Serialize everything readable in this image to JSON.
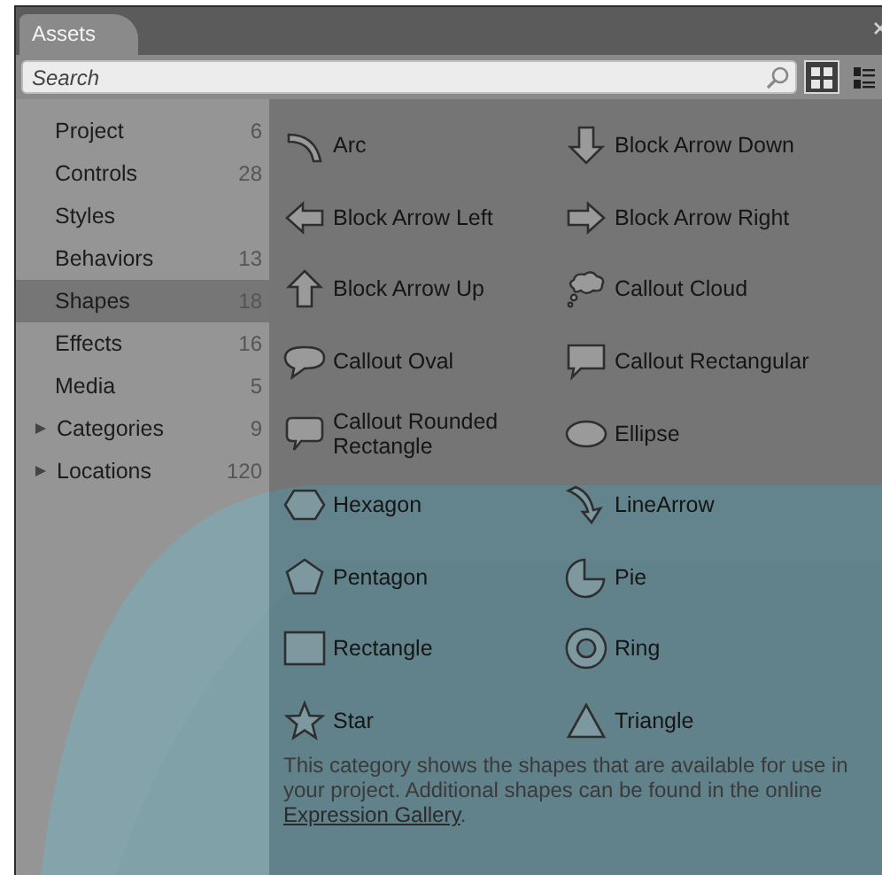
{
  "panel": {
    "tab": "Assets"
  },
  "search": {
    "placeholder": "Search"
  },
  "view_buttons": [
    {
      "kind": "grid",
      "selected": true
    },
    {
      "kind": "list",
      "selected": false
    }
  ],
  "categories": [
    {
      "name": "Project",
      "count": "6",
      "selected": false
    },
    {
      "name": "Controls",
      "count": "28",
      "selected": false
    },
    {
      "name": "Styles",
      "selected": false
    },
    {
      "name": "Behaviors",
      "count": "13",
      "selected": false
    },
    {
      "name": "Shapes",
      "count": "18",
      "selected": true
    },
    {
      "name": "Effects",
      "count": "16",
      "selected": false
    },
    {
      "name": "Media",
      "count": "5",
      "selected": false
    },
    {
      "name": "Categories",
      "count": "9",
      "selected": false,
      "expanded": false
    },
    {
      "name": "Locations",
      "count": "120",
      "selected": false,
      "expanded": false
    }
  ],
  "shapes": [
    {
      "kind": "arc",
      "label": "Arc"
    },
    {
      "kind": "arrow-down",
      "label": "Block Arrow Down"
    },
    {
      "kind": "arrow-left",
      "label": "Block Arrow Left"
    },
    {
      "kind": "arrow-right",
      "label": "Block Arrow Right"
    },
    {
      "kind": "arrow-up",
      "label": "Block Arrow Up"
    },
    {
      "kind": "cloud",
      "label": "Callout Cloud"
    },
    {
      "kind": "oval-callout",
      "label": "Callout Oval"
    },
    {
      "kind": "rect-callout",
      "label": "Callout Rectangular"
    },
    {
      "kind": "rounded-callout",
      "label": "Callout  Rounded Rectangle"
    },
    {
      "kind": "ellipse",
      "label": "Ellipse"
    },
    {
      "kind": "hexagon",
      "label": "Hexagon"
    },
    {
      "kind": "line-arrow",
      "label": "LineArrow"
    },
    {
      "kind": "pentagon",
      "label": "Pentagon"
    },
    {
      "kind": "pie",
      "label": "Pie"
    },
    {
      "kind": "rectangle",
      "label": "Rectangle"
    },
    {
      "kind": "ring",
      "label": "Ring"
    },
    {
      "kind": "star",
      "label": "Star"
    },
    {
      "kind": "triangle",
      "label": "Triangle"
    }
  ],
  "description": {
    "text": "This category shows the shapes that are available for use in your project. Additional shapes can be found in the online",
    "link": "Expression Gallery",
    "after": "."
  }
}
